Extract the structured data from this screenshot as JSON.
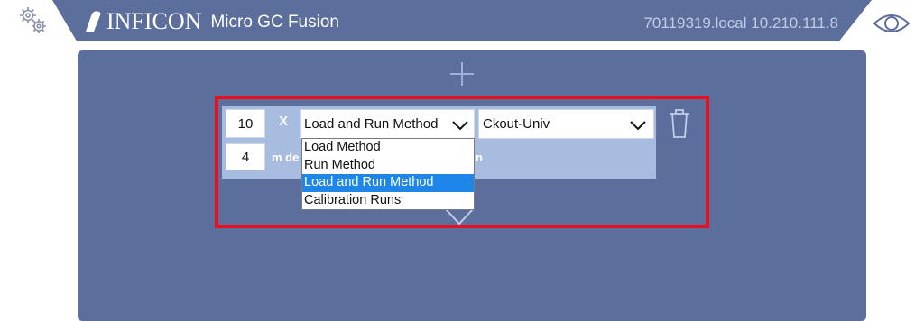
{
  "header": {
    "brand": "INFICON",
    "product": "Micro GC Fusion",
    "host": "70119319.local 10.210.111.8"
  },
  "sequence": {
    "row1": {
      "count": "10",
      "times_label": "X",
      "action_selected": "Load and Run Method",
      "method_selected": "Ckout-Univ"
    },
    "row2": {
      "count": "4",
      "label_fragment": "m de",
      "label_tail": "n"
    },
    "action_options": [
      "Load Method",
      "Run Method",
      "Load and Run Method",
      "Calibration Runs"
    ],
    "action_selected_index": 2
  },
  "colors": {
    "header_bg": "#5b6e9c",
    "panel_bg": "#5b6e9c",
    "row_bg": "#a8bcdf",
    "highlight": "#e8101c",
    "option_selected": "#1e86e8"
  },
  "icons": [
    "settings-gears-icon",
    "inficon-logo-icon",
    "eye-icon",
    "plus-icon",
    "chevron-down-icon",
    "trash-icon"
  ]
}
